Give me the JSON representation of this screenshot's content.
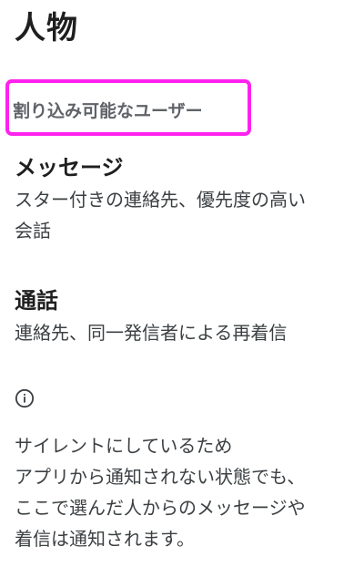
{
  "page": {
    "title": "人物"
  },
  "section": {
    "header": "割り込み可能なユーザー"
  },
  "preferences": [
    {
      "title": "メッセージ",
      "summary_lines": [
        "スター付きの連絡先、優先度の高い",
        "会話"
      ]
    },
    {
      "title": "通話",
      "summary_lines": [
        "連絡先、同一発信者による再着信"
      ]
    }
  ],
  "footer": {
    "icon": "info-icon",
    "lines": [
      "サイレントにしているため",
      "アプリから通知されない状態でも、",
      "ここで選んだ人からのメッセージや",
      "着信は通知されます。"
    ]
  },
  "colors": {
    "highlight_border": "#ff22ee",
    "section_header": "#5f6368",
    "title_text": "#1f1f1f",
    "body_text": "#3c4043"
  }
}
